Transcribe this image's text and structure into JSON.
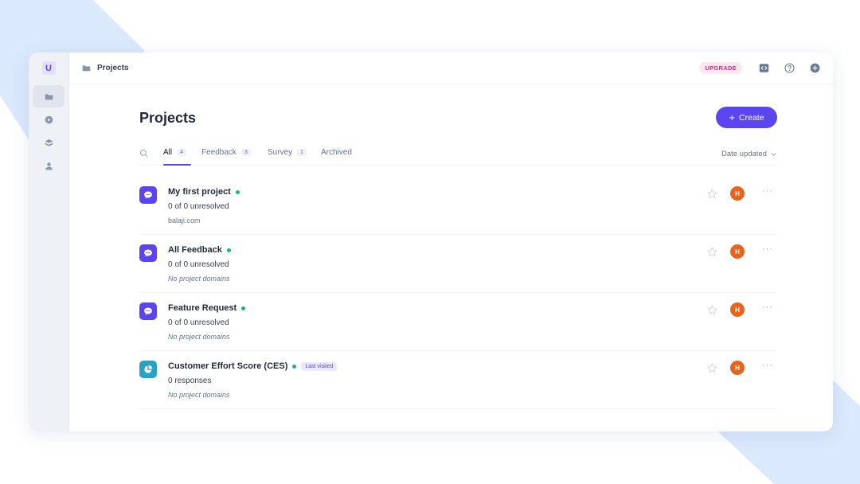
{
  "app": {
    "logo_letter": "U"
  },
  "breadcrumb": {
    "label": "Projects"
  },
  "topbar": {
    "upgrade_label": "UPGRADE"
  },
  "header": {
    "title": "Projects",
    "create_label": "Create"
  },
  "tabs": [
    {
      "label": "All",
      "count": "4"
    },
    {
      "label": "Feedback",
      "count": "3"
    },
    {
      "label": "Survey",
      "count": "1"
    },
    {
      "label": "Archived"
    }
  ],
  "sort": {
    "label": "Date updated"
  },
  "projects": [
    {
      "name": "My first project",
      "subtitle": "0 of 0 unresolved",
      "domain": "balaji.com",
      "avatar": "H"
    },
    {
      "name": "All Feedback",
      "subtitle": "0 of 0 unresolved",
      "domain": "No project domains",
      "avatar": "H"
    },
    {
      "name": "Feature Request",
      "subtitle": "0 of 0 unresolved",
      "domain": "No project domains",
      "avatar": "H"
    },
    {
      "name": "Customer Effort Score (CES)",
      "badge": "Last visited",
      "subtitle": "0 responses",
      "domain": "No project domains",
      "avatar": "H"
    }
  ],
  "colors": {
    "accent": "#5b45f0",
    "online": "#10b981",
    "avatar": "#e8631c",
    "teal": "#27a3c4"
  },
  "icons": {
    "sidebar": [
      "folder-icon",
      "play-icon",
      "layers-icon",
      "user-icon"
    ],
    "topbar": [
      "code-icon",
      "help-icon",
      "plus-circle-icon"
    ]
  }
}
